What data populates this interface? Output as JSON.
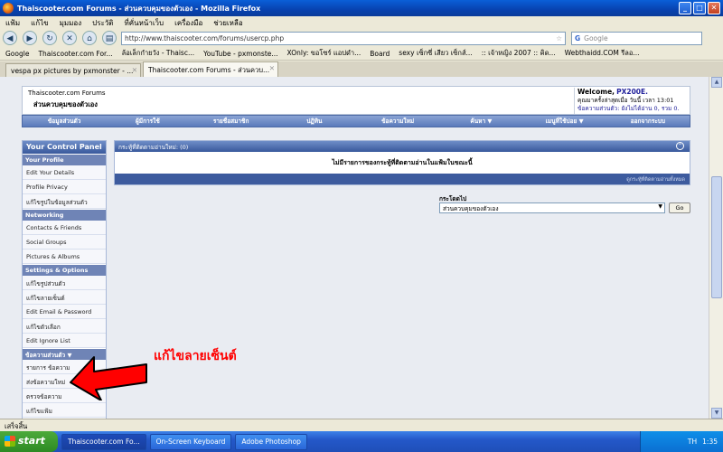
{
  "window": {
    "title": "Thaiscooter.com Forums - ส่วนควบคุมของตัวเอง - Mozilla Firefox",
    "min": "_",
    "max": "□",
    "close": "✕"
  },
  "menu": [
    "แฟ้ม",
    "แก้ไข",
    "มุมมอง",
    "ประวัติ",
    "ที่คั่นหน้าเว็บ",
    "เครื่องมือ",
    "ช่วยเหลือ"
  ],
  "nav": {
    "url": "http://www.thaiscooter.com/forums/usercp.php",
    "search_engine": "G",
    "search_placeholder": "Google"
  },
  "bookmarks": [
    "Google",
    "Thaiscooter.com For...",
    "ล้อเล็กกำยวัง - Thaisc...",
    "YouTube - pxmonste...",
    "XOnly: ขอโซร์ แอปดำ...",
    "Board",
    "sexy เซ็กซี่ เสียว เซ็กส์...",
    ":: เจ้าหญิง 2007 :: คิด...",
    "Webthaidd.COM รีลอ..."
  ],
  "tabs": [
    {
      "label": "vespa px pictures by pxmonster - ..."
    },
    {
      "label": "Thaiscooter.com Forums - ส่วนควบ..."
    }
  ],
  "forum": {
    "breadcrumb_root": "Thaiscooter.com Forums",
    "breadcrumb_page": "ส่วนควบคุมของตัวเอง",
    "welcome": "Welcome,",
    "username": "PX200E.",
    "line2": "คุณมาครั้งล่าสุดเมื่อ วันนี้ เวลา 13:01",
    "line3": "ข้อความส่วนตัว: ยังไม่ได้อ่าน 0, รวม 0."
  },
  "navstrip": [
    "ข้อมูลส่วนตัว",
    "ผู้มีการใช้",
    "รายชื่อสมาชิก",
    "ปฏิทิน",
    "ข้อความใหม่",
    "ค้นหา ▼",
    "เมนูที่ใช้บ่อย ▼",
    "ออกจากระบบ"
  ],
  "control_panel": {
    "title": "Your Control Panel",
    "sections": [
      {
        "heading": "Your Profile",
        "items": [
          "Edit Your Details",
          "Profile Privacy",
          "แก้ไขรูปในข้อมูลส่วนตัว"
        ]
      },
      {
        "heading": "Networking",
        "items": [
          "Contacts & Friends",
          "Social Groups",
          "Pictures & Albums"
        ]
      },
      {
        "heading": "Settings & Options",
        "items": [
          "แก้ไขรูปส่วนตัว",
          "แก้ไขลายเซ็นต์",
          "Edit Email & Password",
          "แก้ไขตัวเลือก",
          "Edit Ignore List"
        ]
      },
      {
        "heading": "ข้อความส่วนตัว ▼",
        "items": [
          "รายการ ข้อความ",
          "ส่งข้อความใหม่",
          "ตรวจข้อความ",
          "แก้ไขแฟ้ม"
        ]
      }
    ]
  },
  "subscribed": {
    "header": "กระทู้ที่ติดตามอ่านใหม่: (0)",
    "empty_message": "ไม่มีรายการของกระทู้ที่ติดตามอ่านในแฟ้มในขณะนี้",
    "footer_link": "ดูกระทู้ที่ติดตามอ่านทั้งหมด"
  },
  "jump": {
    "label": "กระโดดไป",
    "selected": "ส่วนควบคุมของตัวเอง",
    "go": "Go"
  },
  "annotation": {
    "text": "แก้ไขลายเซ็นต์",
    "color": "#ff0000"
  },
  "status": "เสร็จสิ้น",
  "taskbar": {
    "start": "start",
    "buttons": [
      "Thaiscooter.com Fo...",
      "On-Screen Keyboard",
      "Adobe Photoshop"
    ],
    "lang": "TH",
    "time": "1:35"
  }
}
